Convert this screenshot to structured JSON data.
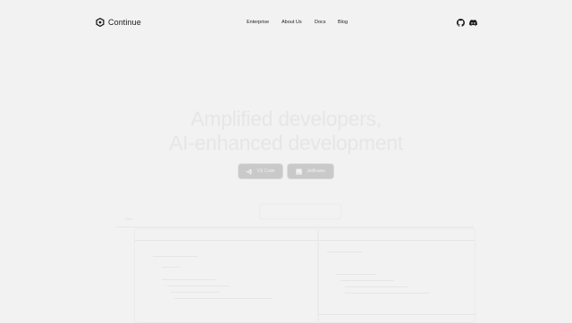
{
  "brand": {
    "name": "Continue"
  },
  "nav": {
    "links": [
      "Enterprise",
      "About Us",
      "Docs",
      "Blog"
    ]
  },
  "social": {
    "icons": [
      "github-icon",
      "discord-icon"
    ]
  },
  "hero": {
    "title_line1": "Amplified developers,",
    "title_line2": "AI-enhanced development",
    "subtitle": ""
  },
  "buttons": {
    "vscode": "VS Code",
    "jetbrains": "JetBrains"
  },
  "colors": {
    "background": "#f2f2f2",
    "text": "#1a1a1a",
    "button": "#c9c9c9"
  }
}
